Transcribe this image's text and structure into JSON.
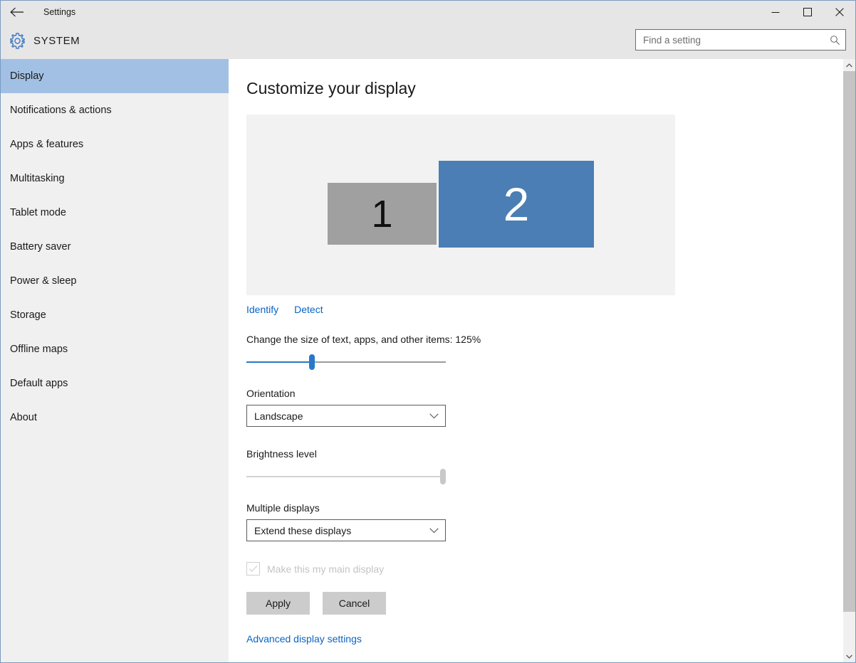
{
  "window": {
    "app_title": "Settings",
    "section_title": "SYSTEM",
    "back_icon": "back-arrow-icon",
    "gear_icon": "gear-icon",
    "controls": {
      "minimize": "minimize-icon",
      "maximize": "maximize-icon",
      "close": "close-icon"
    }
  },
  "search": {
    "placeholder": "Find a setting",
    "value": "",
    "icon": "search-icon"
  },
  "sidebar": {
    "items": [
      {
        "label": "Display",
        "selected": true
      },
      {
        "label": "Notifications & actions",
        "selected": false
      },
      {
        "label": "Apps & features",
        "selected": false
      },
      {
        "label": "Multitasking",
        "selected": false
      },
      {
        "label": "Tablet mode",
        "selected": false
      },
      {
        "label": "Battery saver",
        "selected": false
      },
      {
        "label": "Power & sleep",
        "selected": false
      },
      {
        "label": "Storage",
        "selected": false
      },
      {
        "label": "Offline maps",
        "selected": false
      },
      {
        "label": "Default apps",
        "selected": false
      },
      {
        "label": "About",
        "selected": false
      }
    ]
  },
  "main": {
    "page_title": "Customize your display",
    "preview": {
      "monitors": [
        {
          "number": "1",
          "color": "#a0a0a0",
          "text_color": "#111111",
          "selected": false
        },
        {
          "number": "2",
          "color": "#4a7eb4",
          "text_color": "#ffffff",
          "selected": true
        }
      ]
    },
    "links": {
      "identify": "Identify",
      "detect": "Detect",
      "advanced": "Advanced display settings"
    },
    "scale": {
      "label": "Change the size of text, apps, and other items: 125%",
      "value_percent": 125,
      "slider_position_percent": 33,
      "enabled": true
    },
    "orientation": {
      "label": "Orientation",
      "value": "Landscape",
      "chevron_icon": "chevron-down-icon"
    },
    "brightness": {
      "label": "Brightness level",
      "slider_position_percent": 100,
      "enabled": false
    },
    "multiple_displays": {
      "label": "Multiple displays",
      "value": "Extend these displays",
      "chevron_icon": "chevron-down-icon"
    },
    "main_display_checkbox": {
      "label": "Make this my main display",
      "checked": true,
      "enabled": false
    },
    "buttons": {
      "apply": "Apply",
      "cancel": "Cancel"
    }
  },
  "scrollbar": {
    "up_icon": "scroll-up-icon",
    "down_icon": "scroll-down-icon"
  },
  "colors": {
    "accent_blue": "#2878c8",
    "link_blue": "#0a64c2",
    "selection_blue": "#a2c0e3",
    "chrome_gray": "#e6e6e6",
    "sidebar_gray": "#f0f0f0",
    "window_border": "#7a9ac0"
  }
}
